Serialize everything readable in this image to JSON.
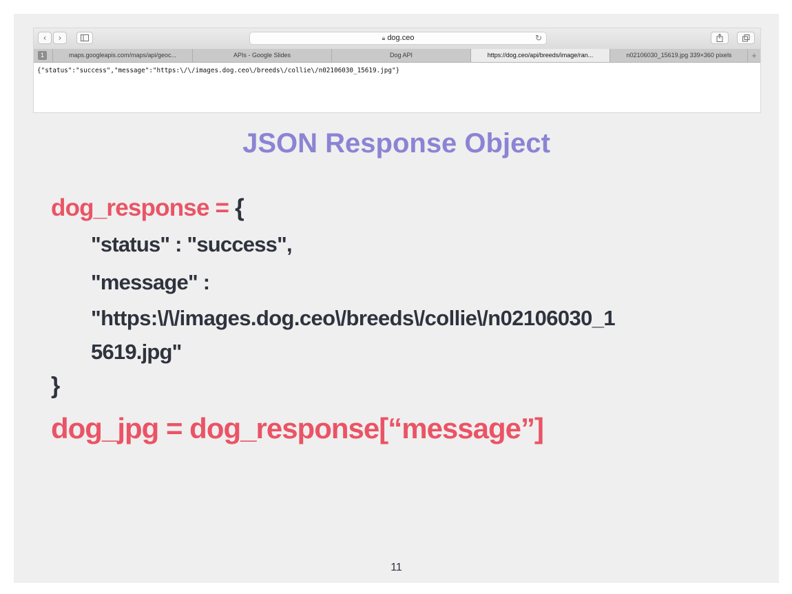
{
  "browser": {
    "address": "dog.ceo",
    "tab_number": "1",
    "tabs": [
      {
        "label": "maps.googleapis.com/maps/api/geoc..."
      },
      {
        "label": "APIs - Google Slides"
      },
      {
        "label": "Dog API"
      },
      {
        "label": "https://dog.ceo/api/breeds/image/ran..."
      },
      {
        "label": "n02106030_15619.jpg 339×360 pixels"
      }
    ],
    "active_tab_index": 3,
    "page_content": "{\"status\":\"success\",\"message\":\"https:\\/\\/images.dog.ceo\\/breeds\\/collie\\/n02106030_15619.jpg\"}"
  },
  "slide": {
    "title": "JSON Response Object",
    "code": {
      "var_assign": "dog_response = ",
      "open_brace": "{",
      "status_line": "\"status\" : \"success\",",
      "message_key": "\"message\" :",
      "message_value_1": "\"https:\\/\\/images.dog.ceo\\/breeds\\/collie\\/n02106030_1",
      "message_value_2": "5619.jpg\"",
      "close_brace": "}",
      "access_line": "dog_jpg = dog_response[“message”]"
    },
    "page_number": "11"
  },
  "colors": {
    "title": "#8b84d4",
    "accent_red": "#ea5465",
    "text_dark": "#2e333d",
    "slide_background": "#efefef"
  },
  "icons": [
    "back-icon",
    "forward-icon",
    "sidebar-icon",
    "lock-icon",
    "reload-icon",
    "share-icon",
    "tabs-overview-icon",
    "new-tab-icon"
  ]
}
